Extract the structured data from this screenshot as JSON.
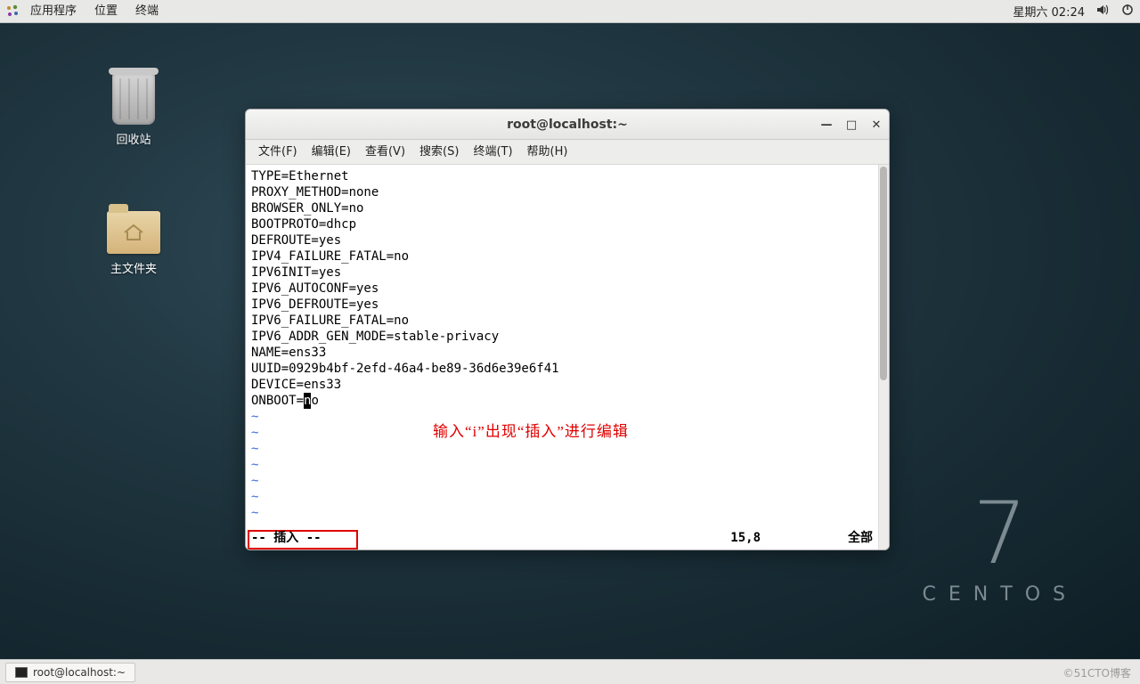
{
  "top_panel": {
    "menus": [
      "应用程序",
      "位置",
      "终端"
    ],
    "clock": "星期六 02:24"
  },
  "desktop_icons": {
    "trash_label": "回收站",
    "home_label": "主文件夹"
  },
  "branding": {
    "number": "7",
    "name": "CENTOS"
  },
  "terminal": {
    "title": "root@localhost:~",
    "window_controls": {
      "minimize": "—",
      "maximize": "□",
      "close": "✕"
    },
    "menus": [
      "文件(F)",
      "编辑(E)",
      "查看(V)",
      "搜索(S)",
      "终端(T)",
      "帮助(H)"
    ],
    "lines": [
      "TYPE=Ethernet",
      "PROXY_METHOD=none",
      "BROWSER_ONLY=no",
      "BOOTPROTO=dhcp",
      "DEFROUTE=yes",
      "IPV4_FAILURE_FATAL=no",
      "IPV6INIT=yes",
      "IPV6_AUTOCONF=yes",
      "IPV6_DEFROUTE=yes",
      "IPV6_FAILURE_FATAL=no",
      "IPV6_ADDR_GEN_MODE=stable-privacy",
      "NAME=ens33",
      "UUID=0929b4bf-2efd-46a4-be89-36d6e39e6f41",
      "DEVICE=ens33"
    ],
    "last_line_prefix": "ONBOOT=",
    "cursor_char": "n",
    "last_line_suffix": "o",
    "tilde": "~",
    "annotation": "输入“i”出现“插入”进行编辑",
    "status_mode": "-- 插入 --",
    "status_pos": "15,8",
    "status_pct": "全部"
  },
  "taskbar": {
    "item_label": "root@localhost:~",
    "watermark": "©51CTO博客"
  }
}
